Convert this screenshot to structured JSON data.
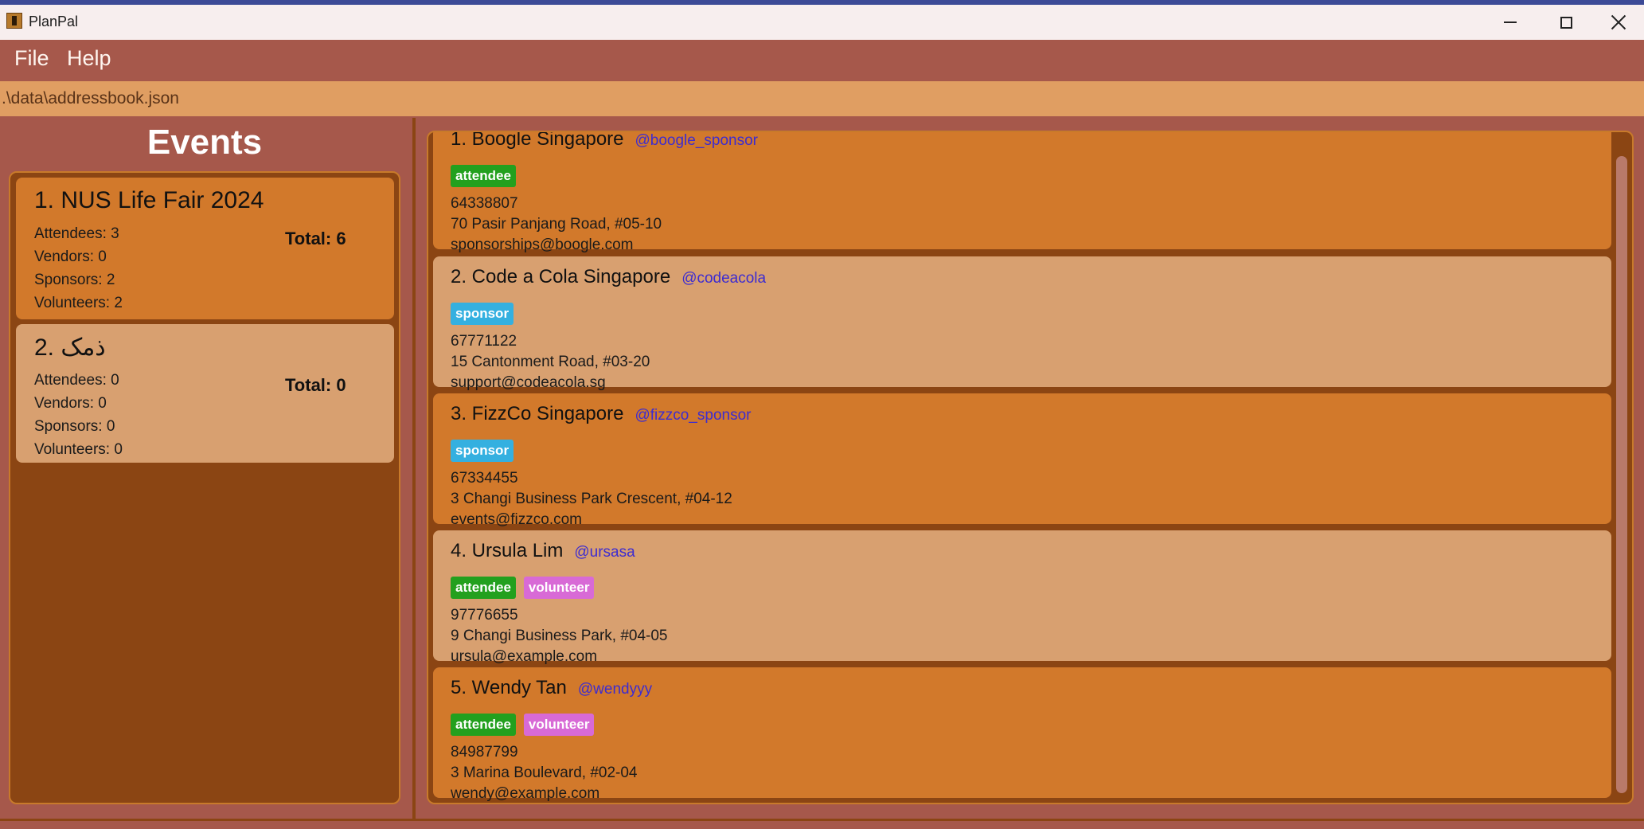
{
  "window": {
    "title": "PlanPal",
    "minimize_icon": "minimize-icon",
    "maximize_icon": "maximize-icon",
    "close_icon": "close-icon"
  },
  "menu": {
    "file": "File",
    "help": "Help"
  },
  "status": {
    "path": ".\\data\\addressbook.json"
  },
  "events": {
    "title": "Events",
    "items": [
      {
        "name": "1. NUS Life Fair 2024",
        "attendees": "Attendees: 3",
        "vendors": "Vendors: 0",
        "sponsors": "Sponsors: 2",
        "volunteers": "Volunteers: 2",
        "total": "Total: 6"
      },
      {
        "name": "2. ذمک",
        "attendees": "Attendees: 0",
        "vendors": "Vendors: 0",
        "sponsors": "Sponsors: 0",
        "volunteers": "Volunteers: 0",
        "total": "Total: 0"
      }
    ]
  },
  "persons": [
    {
      "name": "1. Boogle Singapore",
      "handle": "@boogle_sponsor",
      "tags": [
        "attendee"
      ],
      "phone": "64338807",
      "address": "70 Pasir Panjang Road, #05-10",
      "email": "sponsorships@boogle.com"
    },
    {
      "name": "2. Code a Cola Singapore",
      "handle": "@codeacola",
      "tags": [
        "sponsor"
      ],
      "phone": "67771122",
      "address": "15 Cantonment Road, #03-20",
      "email": "support@codeacola.sg"
    },
    {
      "name": "3. FizzCo Singapore",
      "handle": "@fizzco_sponsor",
      "tags": [
        "sponsor"
      ],
      "phone": "67334455",
      "address": "3 Changi Business Park Crescent, #04-12",
      "email": "events@fizzco.com"
    },
    {
      "name": "4. Ursula Lim",
      "handle": "@ursasa",
      "tags": [
        "attendee",
        "volunteer"
      ],
      "phone": "97776655",
      "address": "9 Changi Business Park, #04-05",
      "email": "ursula@example.com"
    },
    {
      "name": "5. Wendy Tan",
      "handle": "@wendyyy",
      "tags": [
        "attendee",
        "volunteer"
      ],
      "phone": "84987799",
      "address": "3 Marina Boulevard, #02-04",
      "email": "wendy@example.com"
    }
  ],
  "colors": {
    "background": "#a6584b",
    "path_bar": "#e09e62",
    "list_background": "#8b4513",
    "card_dark": "#d2792b",
    "card_light": "#d8a070",
    "tag_attendee": "#23a01e",
    "tag_sponsor": "#34b0e0",
    "tag_volunteer": "#d86ad6",
    "handle": "#3d2cd0"
  }
}
